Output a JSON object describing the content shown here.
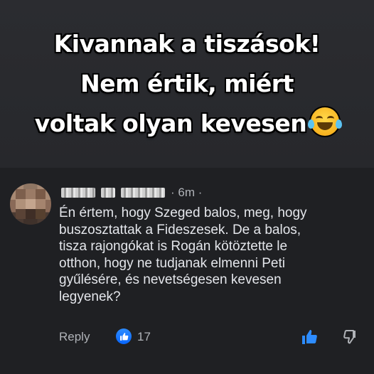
{
  "headline": {
    "lines": [
      "Kivannak a tiszások!",
      "Nem értik, miért",
      "voltak olyan kevesen"
    ],
    "emoji": "face-with-tears-of-joy-icon"
  },
  "comment": {
    "time": "· 6m ·",
    "text_lines": [
      "Én értem, hogy Szeged balos, meg, hogy",
      "buszosztattak a Fideszesek. De a balos,",
      "tisza rajongókat is Rogán kötöztette le",
      "otthon, hogy ne tudjanak elmenni Peti",
      "gyűlésére, és nevetségesen kevesen",
      "legyenek?"
    ],
    "reply_label": "Reply",
    "like_count": "17"
  },
  "colors": {
    "background": "#1f2023",
    "accent": "#0866ff",
    "muted_text": "#b0b3b8",
    "body_text": "#e4e6eb"
  }
}
